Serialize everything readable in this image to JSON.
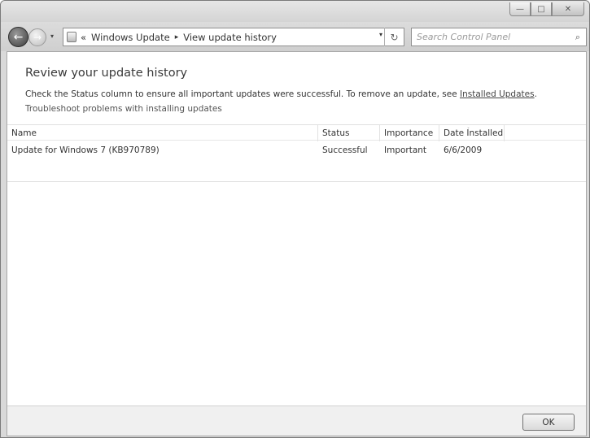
{
  "window": {
    "minimize_glyph": "—",
    "maximize_glyph": "□",
    "close_glyph": "✕"
  },
  "nav": {
    "back_glyph": "←",
    "forward_glyph": "→",
    "history_dropdown_glyph": "▾"
  },
  "address": {
    "chevron": "«",
    "crumbs": [
      "Windows Update",
      "View update history"
    ],
    "separator": "▸",
    "dropdown_glyph": "▾",
    "refresh_glyph": "↻"
  },
  "search": {
    "placeholder": "Search Control Panel",
    "icon_glyph": "⌕"
  },
  "main": {
    "title": "Review your update history",
    "description": "Check the Status column to ensure all important updates were successful. To remove an update, see ",
    "installed_updates_link": "Installed Updates",
    "description_end": ".",
    "troubleshoot": "Troubleshoot problems with installing updates"
  },
  "table": {
    "headers": {
      "name": "Name",
      "status": "Status",
      "importance": "Importance",
      "date": "Date Installed"
    },
    "sort_indicator": "ˇ",
    "rows": [
      {
        "name": "Update for Windows 7  (KB970789)",
        "status": "Successful",
        "importance": "Important",
        "date": "6/6/2009"
      }
    ]
  },
  "footer": {
    "ok_label": "OK"
  }
}
